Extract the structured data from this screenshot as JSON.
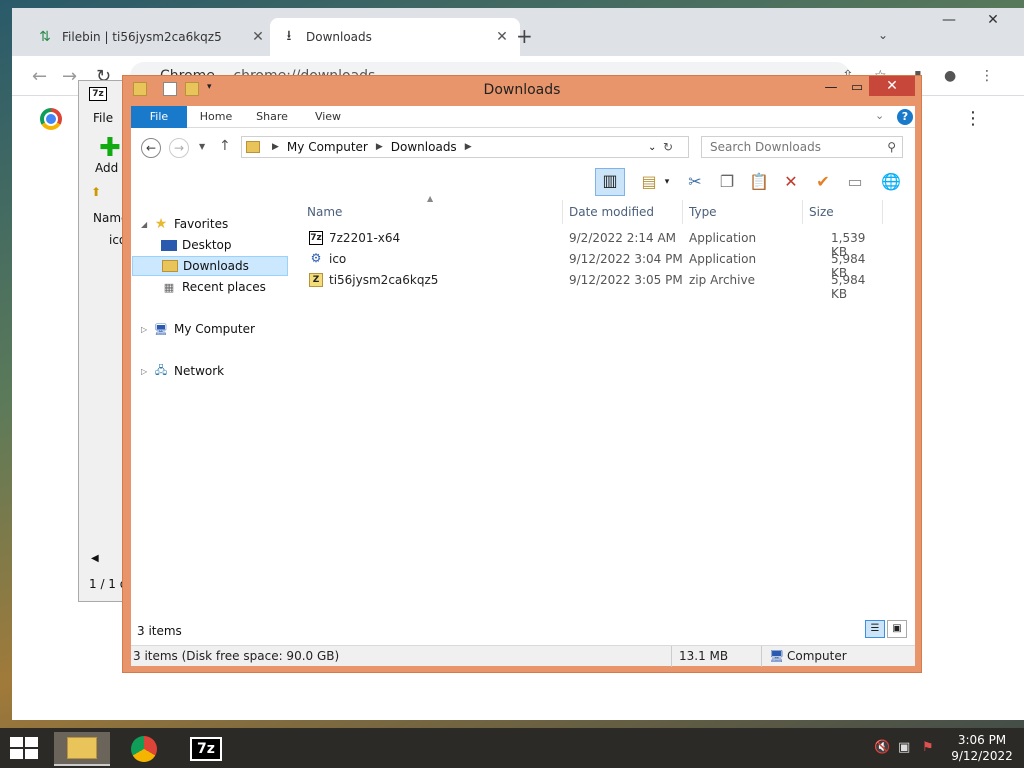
{
  "chrome": {
    "tabs": [
      {
        "label": "Filebin | ti56jysm2ca6kqz5",
        "close": "✕"
      },
      {
        "label": "Downloads",
        "close": "✕"
      }
    ],
    "new_tab": "+",
    "omnibox_chip": "Chrome",
    "url": "chrome://downloads"
  },
  "sevenzip": {
    "logo": "7z",
    "menu_file": "File",
    "add_label": "Add",
    "col_name": "Name",
    "row": "ico",
    "status": "1 / 1 o"
  },
  "explorer": {
    "title": "Downloads",
    "ribbon_tabs": [
      "File",
      "Home",
      "Share",
      "View"
    ],
    "help": "?",
    "breadcrumb": [
      "My Computer",
      "Downloads"
    ],
    "search_placeholder": "Search Downloads",
    "nav": {
      "favorites": "Favorites",
      "desktop": "Desktop",
      "downloads": "Downloads",
      "recent": "Recent places",
      "computer": "My Computer",
      "network": "Network"
    },
    "columns": [
      "Name",
      "Date modified",
      "Type",
      "Size"
    ],
    "files": [
      {
        "name": "7z2201-x64",
        "date": "9/2/2022 2:14 AM",
        "type": "Application",
        "size": "1,539 KB",
        "icon": "7z-icon"
      },
      {
        "name": "ico",
        "date": "9/12/2022 3:04 PM",
        "type": "Application",
        "size": "5,984 KB",
        "icon": "app-icon"
      },
      {
        "name": "ti56jysm2ca6kqz5",
        "date": "9/12/2022 3:05 PM",
        "type": "zip Archive",
        "size": "5,984 KB",
        "icon": "zip-icon"
      }
    ],
    "item_count": "3 items",
    "status_left": "3 items (Disk free space: 90.0 GB)",
    "status_size": "13.1 MB",
    "status_location": "Computer"
  },
  "taskbar": {
    "sevenzip_label": "7z",
    "time": "3:06 PM",
    "date": "9/12/2022"
  }
}
